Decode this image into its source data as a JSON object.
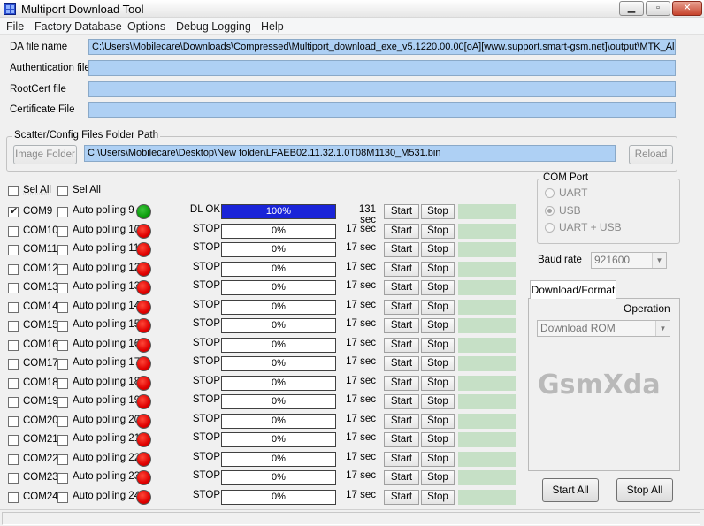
{
  "window": {
    "title": "Multiport Download Tool"
  },
  "menu": [
    "File",
    "Factory Database",
    "Options",
    "Debug Logging",
    "Help"
  ],
  "files": [
    {
      "label": "DA file name",
      "value": "C:\\Users\\Mobilecare\\Downloads\\Compressed\\Multiport_download_exe_v5.1220.00.00[oA][www.support.smart-gsm.net]\\output\\MTK_AllIn"
    },
    {
      "label": "Authentication file",
      "value": ""
    },
    {
      "label": "RootCert file",
      "value": ""
    },
    {
      "label": "Certificate File",
      "value": ""
    }
  ],
  "scatter": {
    "group_title": "Scatter/Config Files Folder Path",
    "image_folder_btn": "Image Folder",
    "path": "C:\\Users\\Mobilecare\\Desktop\\New folder\\LFAEB02.11.32.1.0T08M1130_M531.bin",
    "reload_btn": "Reload"
  },
  "sel_all": [
    "Sel All",
    "Sel All"
  ],
  "ports": [
    {
      "com": "COM9",
      "polling": "Auto polling 9",
      "status": "DL OK",
      "progress": "100%",
      "percent": 100,
      "time": "131 sec",
      "checked": true,
      "light": "green"
    },
    {
      "com": "COM10",
      "polling": "Auto polling 10",
      "status": "STOP",
      "progress": "0%",
      "percent": 0,
      "time": "17 sec",
      "checked": false,
      "light": "red"
    },
    {
      "com": "COM11",
      "polling": "Auto polling 11",
      "status": "STOP",
      "progress": "0%",
      "percent": 0,
      "time": "17 sec",
      "checked": false,
      "light": "red"
    },
    {
      "com": "COM12",
      "polling": "Auto polling 12",
      "status": "STOP",
      "progress": "0%",
      "percent": 0,
      "time": "17 sec",
      "checked": false,
      "light": "red"
    },
    {
      "com": "COM13",
      "polling": "Auto polling 13",
      "status": "STOP",
      "progress": "0%",
      "percent": 0,
      "time": "17 sec",
      "checked": false,
      "light": "red"
    },
    {
      "com": "COM14",
      "polling": "Auto polling 14",
      "status": "STOP",
      "progress": "0%",
      "percent": 0,
      "time": "17 sec",
      "checked": false,
      "light": "red"
    },
    {
      "com": "COM15",
      "polling": "Auto polling 15",
      "status": "STOP",
      "progress": "0%",
      "percent": 0,
      "time": "17 sec",
      "checked": false,
      "light": "red"
    },
    {
      "com": "COM16",
      "polling": "Auto polling 16",
      "status": "STOP",
      "progress": "0%",
      "percent": 0,
      "time": "17 sec",
      "checked": false,
      "light": "red"
    },
    {
      "com": "COM17",
      "polling": "Auto polling 17",
      "status": "STOP",
      "progress": "0%",
      "percent": 0,
      "time": "17 sec",
      "checked": false,
      "light": "red"
    },
    {
      "com": "COM18",
      "polling": "Auto polling 18",
      "status": "STOP",
      "progress": "0%",
      "percent": 0,
      "time": "17 sec",
      "checked": false,
      "light": "red"
    },
    {
      "com": "COM19",
      "polling": "Auto polling 19",
      "status": "STOP",
      "progress": "0%",
      "percent": 0,
      "time": "17 sec",
      "checked": false,
      "light": "red"
    },
    {
      "com": "COM20",
      "polling": "Auto polling 20",
      "status": "STOP",
      "progress": "0%",
      "percent": 0,
      "time": "17 sec",
      "checked": false,
      "light": "red"
    },
    {
      "com": "COM21",
      "polling": "Auto polling 21",
      "status": "STOP",
      "progress": "0%",
      "percent": 0,
      "time": "17 sec",
      "checked": false,
      "light": "red"
    },
    {
      "com": "COM22",
      "polling": "Auto polling 22",
      "status": "STOP",
      "progress": "0%",
      "percent": 0,
      "time": "17 sec",
      "checked": false,
      "light": "red"
    },
    {
      "com": "COM23",
      "polling": "Auto polling 23",
      "status": "STOP",
      "progress": "0%",
      "percent": 0,
      "time": "17 sec",
      "checked": false,
      "light": "red"
    },
    {
      "com": "COM24",
      "polling": "Auto polling 24",
      "status": "STOP",
      "progress": "0%",
      "percent": 0,
      "time": "17 sec",
      "checked": false,
      "light": "red"
    }
  ],
  "row_buttons": {
    "start": "Start",
    "stop": "Stop"
  },
  "com_port": {
    "title": "COM Port",
    "options": [
      "UART",
      "USB",
      "UART + USB"
    ],
    "selected": "USB"
  },
  "baud": {
    "label": "Baud rate",
    "value": "921600"
  },
  "download_tab": {
    "tab_label": "Download/Format",
    "operation_label": "Operation",
    "operation_value": "Download ROM"
  },
  "watermark": "GsmXda",
  "actions": {
    "start_all": "Start All",
    "stop_all": "Stop All"
  },
  "colors": {
    "progress_fill": "#1a24d8",
    "path_bg": "#aed0f4",
    "light_red": "#e00000",
    "light_green": "#0c9c0c"
  }
}
